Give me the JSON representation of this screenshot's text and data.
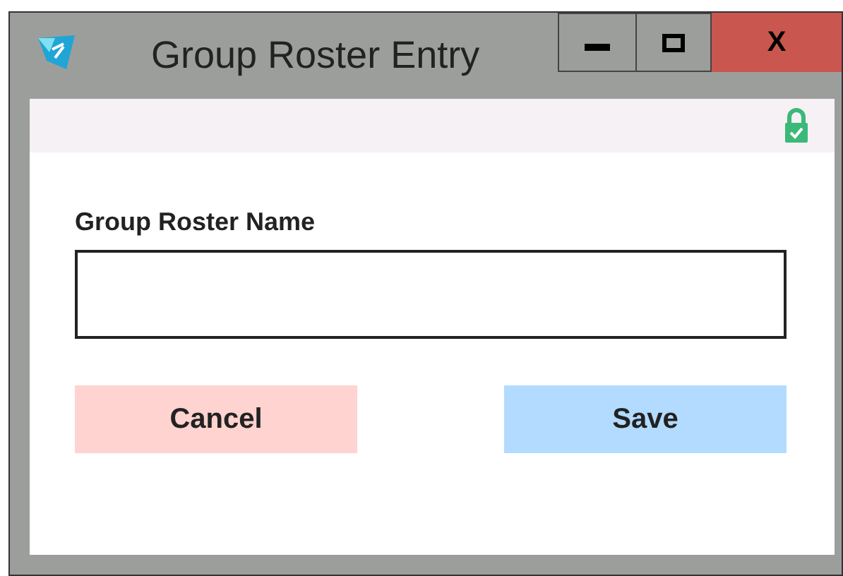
{
  "window": {
    "title": "Group Roster Entry",
    "close_label": "X"
  },
  "form": {
    "field_label": "Group Roster Name"
  },
  "buttons": [
    {
      "label": "Cancel",
      "kind": "cancel"
    },
    {
      "label": "Save",
      "kind": "save"
    }
  ]
}
